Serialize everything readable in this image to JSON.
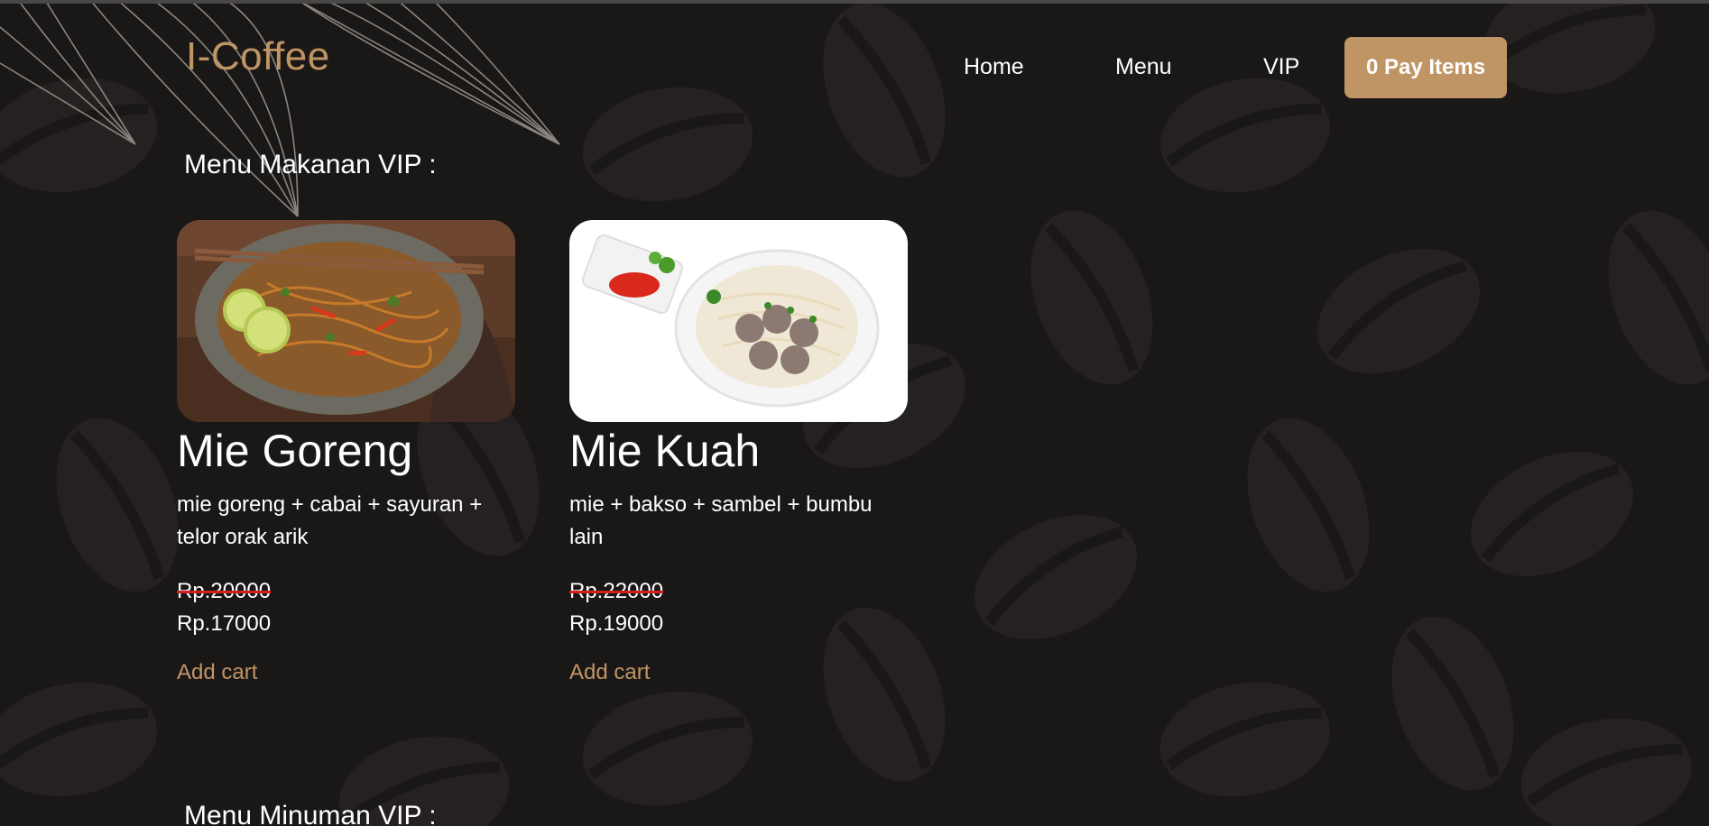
{
  "header": {
    "brand": "I-Coffee",
    "nav": [
      "Home",
      "Menu",
      "VIP"
    ],
    "pay_button": "0 Pay Items"
  },
  "sections": {
    "food_title": "Menu Makanan VIP :",
    "drink_title": "Menu Minuman VIP :"
  },
  "food_items": [
    {
      "name": "Mie Goreng",
      "description": "mie goreng + cabai + sayuran + telor orak arik",
      "old_price": "Rp.20000",
      "new_price": "Rp.17000",
      "add_label": "Add cart"
    },
    {
      "name": "Mie Kuah",
      "description": "mie + bakso + sambel + bumbu lain",
      "old_price": "Rp.22000",
      "new_price": "Rp.19000",
      "add_label": "Add cart"
    }
  ],
  "colors": {
    "background": "#1a1817",
    "accent": "#c09565",
    "strike": "#d21e1e"
  },
  "icons": [
    "coffee-bean-pattern",
    "leaf-decoration"
  ]
}
